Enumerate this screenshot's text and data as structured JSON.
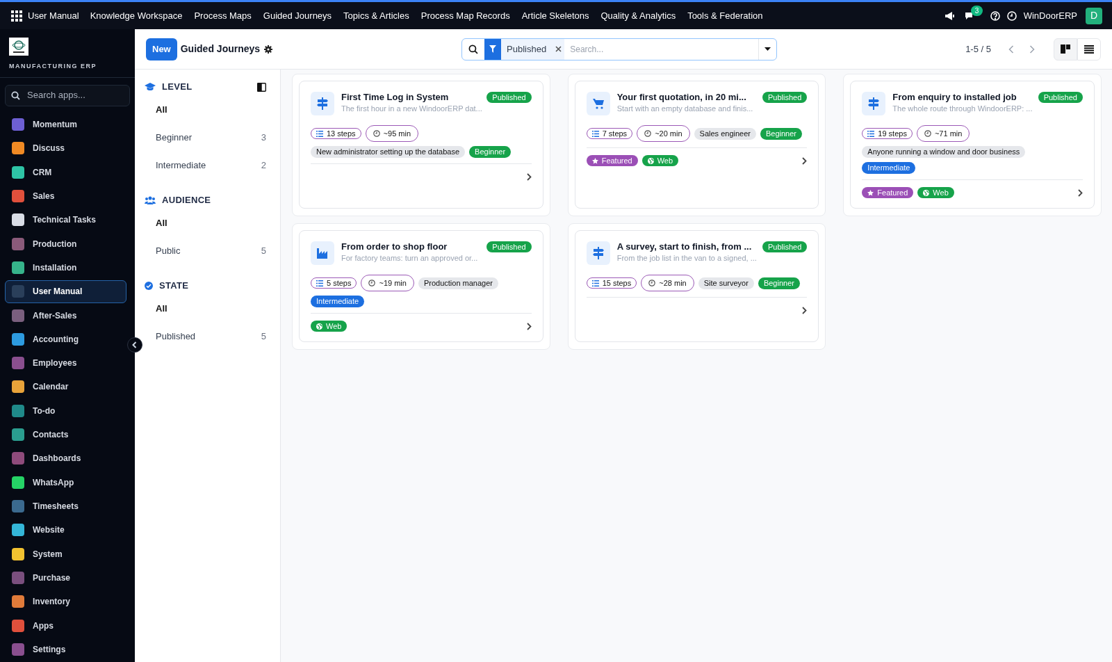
{
  "top_nav": {
    "app_title": "User Manual",
    "menu": [
      "Knowledge Workspace",
      "Process Maps",
      "Guided Journeys",
      "Topics & Articles",
      "Process Map Records",
      "Article Skeletons",
      "Quality & Analytics",
      "Tools & Federation"
    ],
    "message_count": "3",
    "company": "WinDoorERP",
    "avatar": "D"
  },
  "sidebar": {
    "brand": "MANUFACTURING ERP",
    "search_placeholder": "Search apps...",
    "items": [
      {
        "label": "Momentum",
        "color": "#6d5fd3",
        "selected": false
      },
      {
        "label": "Discuss",
        "color": "#f08a24",
        "selected": false
      },
      {
        "label": "CRM",
        "color": "#2ec4a6",
        "selected": false
      },
      {
        "label": "Sales",
        "color": "#e0503c",
        "selected": false
      },
      {
        "label": "Technical Tasks",
        "color": "#d9dde6",
        "selected": false
      },
      {
        "label": "Production",
        "color": "#8a5a7a",
        "selected": false
      },
      {
        "label": "Installation",
        "color": "#36b38a",
        "selected": false
      },
      {
        "label": "User Manual",
        "color": "#2a3f5a",
        "selected": true
      },
      {
        "label": "After-Sales",
        "color": "#7a5f7e",
        "selected": false
      },
      {
        "label": "Accounting",
        "color": "#2d9be0",
        "selected": false
      },
      {
        "label": "Employees",
        "color": "#8a4f8f",
        "selected": false
      },
      {
        "label": "Calendar",
        "color": "#e8a33a",
        "selected": false
      },
      {
        "label": "To-do",
        "color": "#1f8a8a",
        "selected": false
      },
      {
        "label": "Contacts",
        "color": "#2a9d8f",
        "selected": false
      },
      {
        "label": "Dashboards",
        "color": "#8e4b7b",
        "selected": false
      },
      {
        "label": "WhatsApp",
        "color": "#25d366",
        "selected": false
      },
      {
        "label": "Timesheets",
        "color": "#3b6a8f",
        "selected": false
      },
      {
        "label": "Website",
        "color": "#34b6d8",
        "selected": false
      },
      {
        "label": "System",
        "color": "#f2c230",
        "selected": false
      },
      {
        "label": "Purchase",
        "color": "#7a4f7e",
        "selected": false
      },
      {
        "label": "Inventory",
        "color": "#e07b3a",
        "selected": false
      },
      {
        "label": "Apps",
        "color": "#e0503c",
        "selected": false
      },
      {
        "label": "Settings",
        "color": "#8a4f8f",
        "selected": false
      }
    ]
  },
  "control_panel": {
    "new_button": "New",
    "title": "Guided Journeys",
    "facet": "Published",
    "search_placeholder": "Search...",
    "pager": "1-5 / 5"
  },
  "filter_panel": [
    {
      "title": "LEVEL",
      "kind": "level",
      "items": [
        {
          "label": "All",
          "selected": true
        },
        {
          "label": "Beginner",
          "count": "3",
          "selected": false
        },
        {
          "label": "Intermediate",
          "count": "2",
          "selected": false
        }
      ]
    },
    {
      "title": "AUDIENCE",
      "kind": "audience",
      "items": [
        {
          "label": "All",
          "selected": true
        },
        {
          "label": "Public",
          "count": "5",
          "selected": false
        }
      ]
    },
    {
      "title": "STATE",
      "kind": "state",
      "items": [
        {
          "label": "All",
          "selected": true
        },
        {
          "label": "Published",
          "count": "5",
          "selected": false
        }
      ]
    }
  ],
  "cards": [
    {
      "kind": "signpost",
      "title": "First Time Log in System",
      "subtitle": "The first hour in a new WindoorERP dat...",
      "status": "Published",
      "steps": "13 steps",
      "duration": "~95 min",
      "audience": "New administrator setting up the database",
      "level": {
        "label": "Beginner",
        "color": "#16a34a"
      }
    },
    {
      "kind": "cart",
      "title": "Your first quotation, in 20 mi...",
      "subtitle": "Start with an empty database and finis...",
      "status": "Published",
      "steps": "7 steps",
      "duration": "~20 min",
      "audience": "Sales engineer",
      "level": {
        "label": "Beginner",
        "color": "#16a34a"
      },
      "badges": [
        {
          "kind": "featured",
          "label": "Featured"
        },
        {
          "kind": "web",
          "label": "Web"
        }
      ]
    },
    {
      "kind": "signpost",
      "title": "From enquiry to installed job",
      "subtitle": "The whole route through WindoorERP: ...",
      "status": "Published",
      "steps": "19 steps",
      "duration": "~71 min",
      "audience": "Anyone running a window and door business",
      "level": {
        "label": "Intermediate",
        "color": "#1d6fe0"
      },
      "badges": [
        {
          "kind": "featured",
          "label": "Featured"
        },
        {
          "kind": "web",
          "label": "Web"
        }
      ]
    },
    {
      "kind": "factory",
      "title": "From order to shop floor",
      "subtitle": "For factory teams: turn an approved or...",
      "status": "Published",
      "steps": "5 steps",
      "duration": "~19 min",
      "audience": "Production manager",
      "level": {
        "label": "Intermediate",
        "color": "#1d6fe0"
      },
      "badges": [
        {
          "kind": "web",
          "label": "Web"
        }
      ]
    },
    {
      "kind": "signpost",
      "title": "A survey, start to finish, from ...",
      "subtitle": "From the job list in the van to a signed, ...",
      "status": "Published",
      "steps": "15 steps",
      "duration": "~28 min",
      "audience": "Site surveyor",
      "level": {
        "label": "Beginner",
        "color": "#16a34a"
      }
    }
  ]
}
